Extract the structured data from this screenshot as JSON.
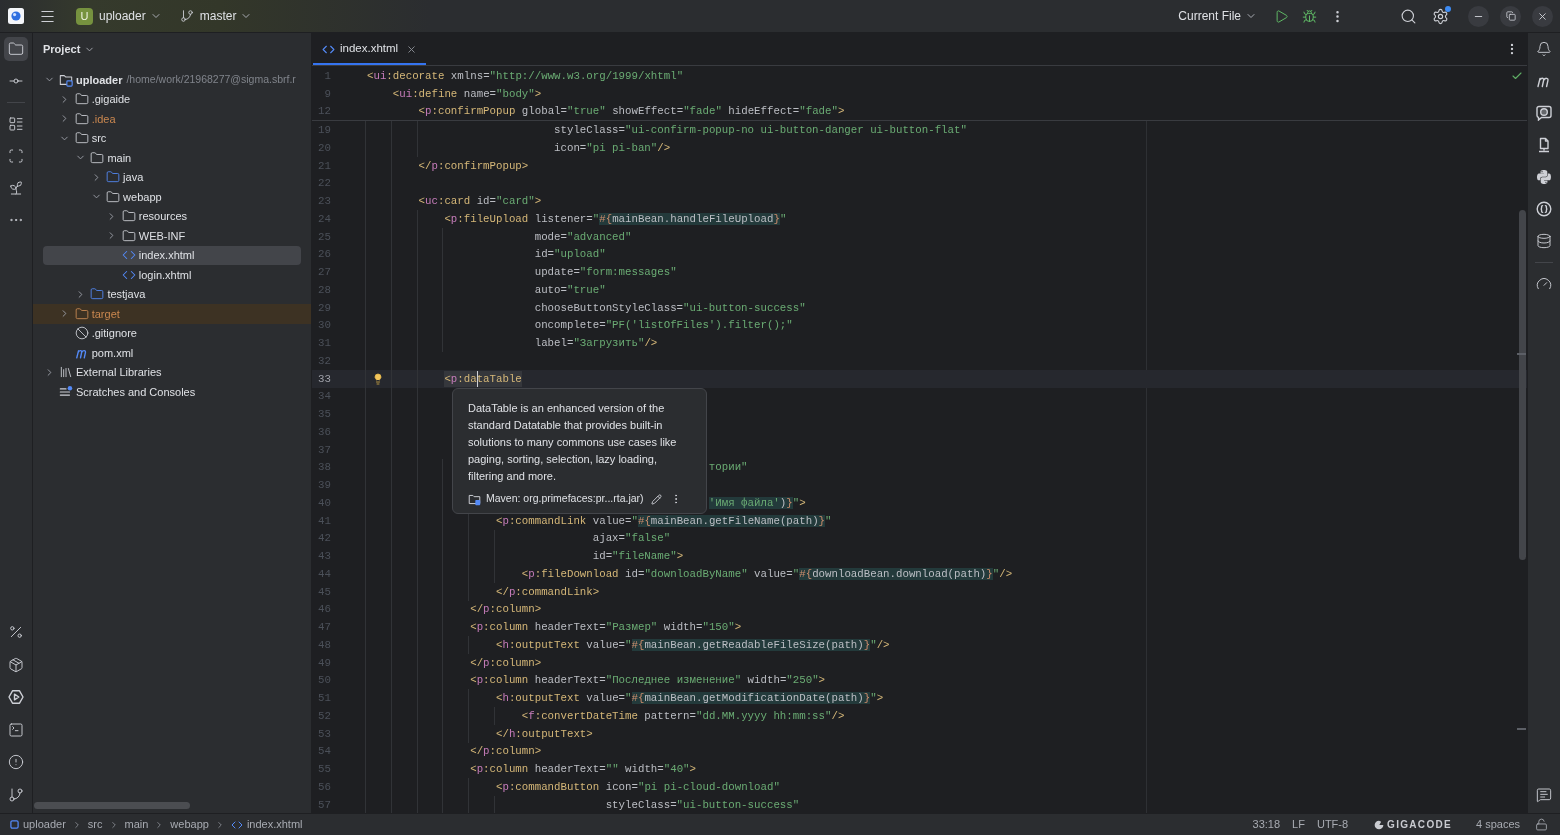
{
  "title_bar": {
    "project_badge": "U",
    "project": "uploader",
    "branch": "master",
    "run_configuration": "Current File",
    "settings_update_dot": true
  },
  "left_toolbar": {
    "top": [
      {
        "selected": true
      },
      {
        "selected": false
      },
      {
        "selected": false
      },
      {
        "selected": false
      },
      {
        "selected": false
      },
      {
        "selected": false
      }
    ],
    "bottom": [
      {
        "selected": false
      },
      {
        "selected": false
      },
      {
        "selected": false
      },
      {
        "selected": false
      },
      {
        "selected": false
      },
      {
        "selected": false
      }
    ]
  },
  "project_panel": {
    "title": "Project",
    "tree": [
      {
        "kind": "module",
        "label": "uploader",
        "path": "/home/work/21968277@sigma.sbrf.r",
        "expanded": true,
        "selected": false,
        "children": [
          {
            "kind": "folder",
            "label": ".gigaide",
            "expanded": false,
            "selected": false
          },
          {
            "kind": "folder",
            "label": ".idea",
            "color": "#c9874f",
            "expanded": false,
            "selected": false
          },
          {
            "kind": "folder",
            "label": "src",
            "expanded": true,
            "selected": false,
            "children": [
              {
                "kind": "folder",
                "label": "main",
                "expanded": true,
                "selected": false,
                "children": [
                  {
                    "kind": "source-folder",
                    "label": "java",
                    "expanded": false,
                    "selected": false
                  },
                  {
                    "kind": "folder",
                    "label": "webapp",
                    "expanded": true,
                    "selected": false,
                    "children": [
                      {
                        "kind": "folder",
                        "label": "resources",
                        "expanded": false,
                        "selected": false
                      },
                      {
                        "kind": "folder",
                        "label": "WEB-INF",
                        "expanded": false,
                        "selected": false
                      },
                      {
                        "kind": "xhtml",
                        "label": "index.xhtml",
                        "selected": true
                      },
                      {
                        "kind": "xhtml",
                        "label": "login.xhtml",
                        "selected": false
                      }
                    ]
                  }
                ]
              },
              {
                "kind": "source-folder",
                "label": "testjava",
                "expanded": false,
                "selected": false
              }
            ]
          },
          {
            "kind": "excluded-folder",
            "label": "target",
            "color": "#c9874f",
            "expanded": false,
            "selected": false
          },
          {
            "kind": "gitignore",
            "label": ".gitignore",
            "selected": false
          },
          {
            "kind": "maven",
            "label": "pom.xml",
            "selected": false
          }
        ]
      },
      {
        "kind": "libraries",
        "label": "External Libraries",
        "expanded": false,
        "selected": false
      },
      {
        "kind": "scratches",
        "label": "Scratches and Consoles",
        "selected": false
      }
    ]
  },
  "editor": {
    "tabs": [
      {
        "label": "index.xhtml",
        "selected": true
      }
    ],
    "inspection_ok": true,
    "sticky_lines": [
      {
        "number": "1",
        "tokens": [
          {
            "kind": "tag",
            "text": "<"
          },
          {
            "kind": "ns",
            "text": "ui"
          },
          {
            "kind": "tag",
            "text": ":decorate"
          },
          {
            "kind": "attr",
            "text": " xmlns="
          },
          {
            "kind": "str",
            "text": "\"http://www.w3.org/1999/xhtml\""
          }
        ]
      },
      {
        "number": "9",
        "tokens": [
          {
            "kind": "tag",
            "text": "    <"
          },
          {
            "kind": "ns",
            "text": "ui"
          },
          {
            "kind": "tag",
            "text": ":define"
          },
          {
            "kind": "attr",
            "text": " name="
          },
          {
            "kind": "str",
            "text": "\"body\""
          },
          {
            "kind": "tag",
            "text": ">"
          }
        ]
      },
      {
        "number": "12",
        "tokens": [
          {
            "kind": "tag",
            "text": "        <"
          },
          {
            "kind": "ns",
            "text": "p"
          },
          {
            "kind": "tag",
            "text": ":confirmPopup"
          },
          {
            "kind": "attr",
            "text": " global="
          },
          {
            "kind": "str",
            "text": "\"true\""
          },
          {
            "kind": "attr",
            "text": " showEffect="
          },
          {
            "kind": "str",
            "text": "\"fade\""
          },
          {
            "kind": "attr",
            "text": " hideEffect="
          },
          {
            "kind": "str",
            "text": "\"fade\""
          },
          {
            "kind": "tag",
            "text": ">"
          }
        ]
      }
    ],
    "lines": [
      {
        "number": "19",
        "tokens": [
          {
            "kind": "attr",
            "text": "                             styleClass="
          },
          {
            "kind": "str",
            "text": "\"ui-confirm-popup-no ui-button-danger ui-button-flat\""
          }
        ]
      },
      {
        "number": "20",
        "tokens": [
          {
            "kind": "attr",
            "text": "                             icon="
          },
          {
            "kind": "str",
            "text": "\"pi pi-ban\""
          },
          {
            "kind": "tag",
            "text": "/>"
          }
        ]
      },
      {
        "number": "21",
        "tokens": [
          {
            "kind": "tag",
            "text": "        </"
          },
          {
            "kind": "ns",
            "text": "p"
          },
          {
            "kind": "tag",
            "text": ":confirmPopup"
          },
          {
            "kind": "tag",
            "text": ">"
          }
        ]
      },
      {
        "number": "22"
      },
      {
        "number": "23",
        "tokens": [
          {
            "kind": "tag",
            "text": "        <"
          },
          {
            "kind": "ns",
            "text": "uc"
          },
          {
            "kind": "tag",
            "text": ":card"
          },
          {
            "kind": "attr",
            "text": " id="
          },
          {
            "kind": "str",
            "text": "\"card\""
          },
          {
            "kind": "tag",
            "text": ">"
          }
        ]
      },
      {
        "number": "24",
        "tokens": [
          {
            "kind": "tag",
            "text": "            <"
          },
          {
            "kind": "ns",
            "text": "p"
          },
          {
            "kind": "tag",
            "text": ":fileUpload"
          },
          {
            "kind": "attr",
            "text": " listener="
          },
          {
            "kind": "str",
            "text": "\""
          },
          {
            "kind": "el",
            "text": "#{"
          },
          {
            "kind": "el-text",
            "text": "mainBean.handleFileUpload"
          },
          {
            "kind": "el",
            "text": "}"
          },
          {
            "kind": "str",
            "text": "\""
          }
        ]
      },
      {
        "number": "25",
        "tokens": [
          {
            "kind": "attr",
            "text": "                          mode="
          },
          {
            "kind": "str",
            "text": "\"advanced\""
          }
        ]
      },
      {
        "number": "26",
        "tokens": [
          {
            "kind": "attr",
            "text": "                          id="
          },
          {
            "kind": "str",
            "text": "\"upload\""
          }
        ]
      },
      {
        "number": "27",
        "tokens": [
          {
            "kind": "attr",
            "text": "                          update="
          },
          {
            "kind": "str",
            "text": "\"form:messages\""
          }
        ]
      },
      {
        "number": "28",
        "tokens": [
          {
            "kind": "attr",
            "text": "                          auto="
          },
          {
            "kind": "str",
            "text": "\"true\""
          }
        ]
      },
      {
        "number": "29",
        "tokens": [
          {
            "kind": "attr",
            "text": "                          chooseButtonStyleClass="
          },
          {
            "kind": "str",
            "text": "\"ui-button-success\""
          }
        ]
      },
      {
        "number": "30",
        "tokens": [
          {
            "kind": "attr",
            "text": "                          oncomplete="
          },
          {
            "kind": "str",
            "text": "\"PF('listOfFiles').filter();\""
          }
        ]
      },
      {
        "number": "31",
        "tokens": [
          {
            "kind": "attr",
            "text": "                          label="
          },
          {
            "kind": "str",
            "text": "\"Загрузить\""
          },
          {
            "kind": "tag",
            "text": "/>"
          }
        ]
      },
      {
        "number": "32"
      },
      {
        "number": "33",
        "tokens": [
          {
            "kind": "tag",
            "text": "            <"
          },
          {
            "kind": "ns",
            "text": "p"
          },
          {
            "kind": "tag",
            "text": ":da"
          },
          {
            "kind": "caret"
          },
          {
            "kind": "tag",
            "text": "taTable"
          }
        ]
      },
      {
        "number": "34"
      },
      {
        "number": "35"
      },
      {
        "number": "36"
      },
      {
        "number": "37"
      },
      {
        "number": "38",
        "tokens": [
          {
            "kind": "str",
            "text": "                                                     тории\""
          }
        ]
      },
      {
        "number": "39"
      },
      {
        "number": "40",
        "tokens": [
          {
            "kind": "el-str",
            "text": "                                                     'Имя файла'"
          },
          {
            "kind": "el-text",
            "text": ")"
          },
          {
            "kind": "el",
            "text": "}"
          },
          {
            "kind": "str",
            "text": "\""
          },
          {
            "kind": "tag",
            "text": ">"
          }
        ]
      },
      {
        "number": "41",
        "tokens": [
          {
            "kind": "tag",
            "text": "                    <"
          },
          {
            "kind": "ns",
            "text": "p"
          },
          {
            "kind": "tag",
            "text": ":commandLink"
          },
          {
            "kind": "attr",
            "text": " value="
          },
          {
            "kind": "str",
            "text": "\""
          },
          {
            "kind": "el",
            "text": "#{"
          },
          {
            "kind": "el-text",
            "text": "mainBean.getFileName(path)"
          },
          {
            "kind": "el",
            "text": "}"
          },
          {
            "kind": "str",
            "text": "\""
          }
        ]
      },
      {
        "number": "42",
        "tokens": [
          {
            "kind": "attr",
            "text": "                                   ajax="
          },
          {
            "kind": "str",
            "text": "\"false\""
          }
        ]
      },
      {
        "number": "43",
        "tokens": [
          {
            "kind": "attr",
            "text": "                                   id="
          },
          {
            "kind": "str",
            "text": "\"fileName\""
          },
          {
            "kind": "tag",
            "text": ">"
          }
        ]
      },
      {
        "number": "44",
        "tokens": [
          {
            "kind": "tag",
            "text": "                        <"
          },
          {
            "kind": "ns",
            "text": "p"
          },
          {
            "kind": "tag",
            "text": ":fileDownload"
          },
          {
            "kind": "attr",
            "text": " id="
          },
          {
            "kind": "str",
            "text": "\"downloadByName\""
          },
          {
            "kind": "attr",
            "text": " value="
          },
          {
            "kind": "str",
            "text": "\""
          },
          {
            "kind": "el",
            "text": "#{"
          },
          {
            "kind": "el-text",
            "text": "downloadBean.download(path)"
          },
          {
            "kind": "el",
            "text": "}"
          },
          {
            "kind": "str",
            "text": "\""
          },
          {
            "kind": "tag",
            "text": "/>"
          }
        ]
      },
      {
        "number": "45",
        "tokens": [
          {
            "kind": "tag",
            "text": "                    </"
          },
          {
            "kind": "ns",
            "text": "p"
          },
          {
            "kind": "tag",
            "text": ":commandLink"
          },
          {
            "kind": "tag",
            "text": ">"
          }
        ]
      },
      {
        "number": "46",
        "tokens": [
          {
            "kind": "tag",
            "text": "                </"
          },
          {
            "kind": "ns",
            "text": "p"
          },
          {
            "kind": "tag",
            "text": ":column"
          },
          {
            "kind": "tag",
            "text": ">"
          }
        ]
      },
      {
        "number": "47",
        "tokens": [
          {
            "kind": "tag",
            "text": "                <"
          },
          {
            "kind": "ns",
            "text": "p"
          },
          {
            "kind": "tag",
            "text": ":column"
          },
          {
            "kind": "attr",
            "text": " headerText="
          },
          {
            "kind": "str",
            "text": "\"Размер\""
          },
          {
            "kind": "attr",
            "text": " width="
          },
          {
            "kind": "str",
            "text": "\"150\""
          },
          {
            "kind": "tag",
            "text": ">"
          }
        ]
      },
      {
        "number": "48",
        "tokens": [
          {
            "kind": "tag",
            "text": "                    <"
          },
          {
            "kind": "ns",
            "text": "h"
          },
          {
            "kind": "tag",
            "text": ":outputText"
          },
          {
            "kind": "attr",
            "text": " value="
          },
          {
            "kind": "str",
            "text": "\""
          },
          {
            "kind": "el",
            "text": "#{"
          },
          {
            "kind": "el-text",
            "text": "mainBean.getReadableFileSize(path)"
          },
          {
            "kind": "el",
            "text": "}"
          },
          {
            "kind": "str",
            "text": "\""
          },
          {
            "kind": "tag",
            "text": "/>"
          }
        ]
      },
      {
        "number": "49",
        "tokens": [
          {
            "kind": "tag",
            "text": "                </"
          },
          {
            "kind": "ns",
            "text": "p"
          },
          {
            "kind": "tag",
            "text": ":column"
          },
          {
            "kind": "tag",
            "text": ">"
          }
        ]
      },
      {
        "number": "50",
        "tokens": [
          {
            "kind": "tag",
            "text": "                <"
          },
          {
            "kind": "ns",
            "text": "p"
          },
          {
            "kind": "tag",
            "text": ":column"
          },
          {
            "kind": "attr",
            "text": " headerText="
          },
          {
            "kind": "str",
            "text": "\"Последнее изменение\""
          },
          {
            "kind": "attr",
            "text": " width="
          },
          {
            "kind": "str",
            "text": "\"250\""
          },
          {
            "kind": "tag",
            "text": ">"
          }
        ]
      },
      {
        "number": "51",
        "tokens": [
          {
            "kind": "tag",
            "text": "                    <"
          },
          {
            "kind": "ns",
            "text": "h"
          },
          {
            "kind": "tag",
            "text": ":outputText"
          },
          {
            "kind": "attr",
            "text": " value="
          },
          {
            "kind": "str",
            "text": "\""
          },
          {
            "kind": "el",
            "text": "#{"
          },
          {
            "kind": "el-text",
            "text": "mainBean.getModificationDate(path)"
          },
          {
            "kind": "el",
            "text": "}"
          },
          {
            "kind": "str",
            "text": "\""
          },
          {
            "kind": "tag",
            "text": ">"
          }
        ]
      },
      {
        "number": "52",
        "tokens": [
          {
            "kind": "tag",
            "text": "                        <"
          },
          {
            "kind": "ns",
            "text": "f"
          },
          {
            "kind": "tag",
            "text": ":convertDateTime"
          },
          {
            "kind": "attr",
            "text": " pattern="
          },
          {
            "kind": "str",
            "text": "\"dd.MM.yyyy hh:mm:ss\""
          },
          {
            "kind": "tag",
            "text": "/>"
          }
        ]
      },
      {
        "number": "53",
        "tokens": [
          {
            "kind": "tag",
            "text": "                    </"
          },
          {
            "kind": "ns",
            "text": "h"
          },
          {
            "kind": "tag",
            "text": ":outputText"
          },
          {
            "kind": "tag",
            "text": ">"
          }
        ]
      },
      {
        "number": "54",
        "tokens": [
          {
            "kind": "tag",
            "text": "                </"
          },
          {
            "kind": "ns",
            "text": "p"
          },
          {
            "kind": "tag",
            "text": ":column"
          },
          {
            "kind": "tag",
            "text": ">"
          }
        ]
      },
      {
        "number": "55",
        "tokens": [
          {
            "kind": "tag",
            "text": "                <"
          },
          {
            "kind": "ns",
            "text": "p"
          },
          {
            "kind": "tag",
            "text": ":column"
          },
          {
            "kind": "attr",
            "text": " headerText="
          },
          {
            "kind": "str",
            "text": "\"\""
          },
          {
            "kind": "attr",
            "text": " width="
          },
          {
            "kind": "str",
            "text": "\"40\""
          },
          {
            "kind": "tag",
            "text": ">"
          }
        ]
      },
      {
        "number": "56",
        "tokens": [
          {
            "kind": "tag",
            "text": "                    <"
          },
          {
            "kind": "ns",
            "text": "p"
          },
          {
            "kind": "tag",
            "text": ":commandButton"
          },
          {
            "kind": "attr",
            "text": " icon="
          },
          {
            "kind": "str",
            "text": "\"pi pi-cloud-download\""
          }
        ]
      },
      {
        "number": "57",
        "tokens": [
          {
            "kind": "attr",
            "text": "                                     styleClass="
          },
          {
            "kind": "str",
            "text": "\"ui-button-success\""
          }
        ]
      }
    ],
    "documentation_popup": {
      "text": "DataTable is an enhanced version of the standard Datatable that provides built-in solutions to many commons use cases like paging, sorting, selection, lazy loading, filtering and more.",
      "source": "Maven: org.primefaces:pr...rta.jar)"
    }
  },
  "right_toolbar": {
    "top": [
      {
        "selected": false
      },
      {
        "selected": false
      },
      {
        "selected": false
      },
      {
        "selected": false
      },
      {
        "selected": false
      },
      {
        "selected": false
      },
      {
        "selected": false
      },
      {
        "selected": false
      }
    ],
    "bottom": [
      {
        "selected": false
      }
    ]
  },
  "status_bar": {
    "breadcrumbs": [
      {
        "kind": "module",
        "label": "uploader"
      },
      {
        "kind": "folder",
        "label": "src"
      },
      {
        "kind": "folder",
        "label": "main"
      },
      {
        "kind": "folder",
        "label": "webapp"
      },
      {
        "kind": "xhtml",
        "label": "index.xhtml"
      }
    ],
    "caret_position": "33:18",
    "line_separator": "LF",
    "encoding": "UTF-8",
    "assistant": "GIGACODE",
    "indentation": "4 spaces",
    "read_only": false
  }
}
